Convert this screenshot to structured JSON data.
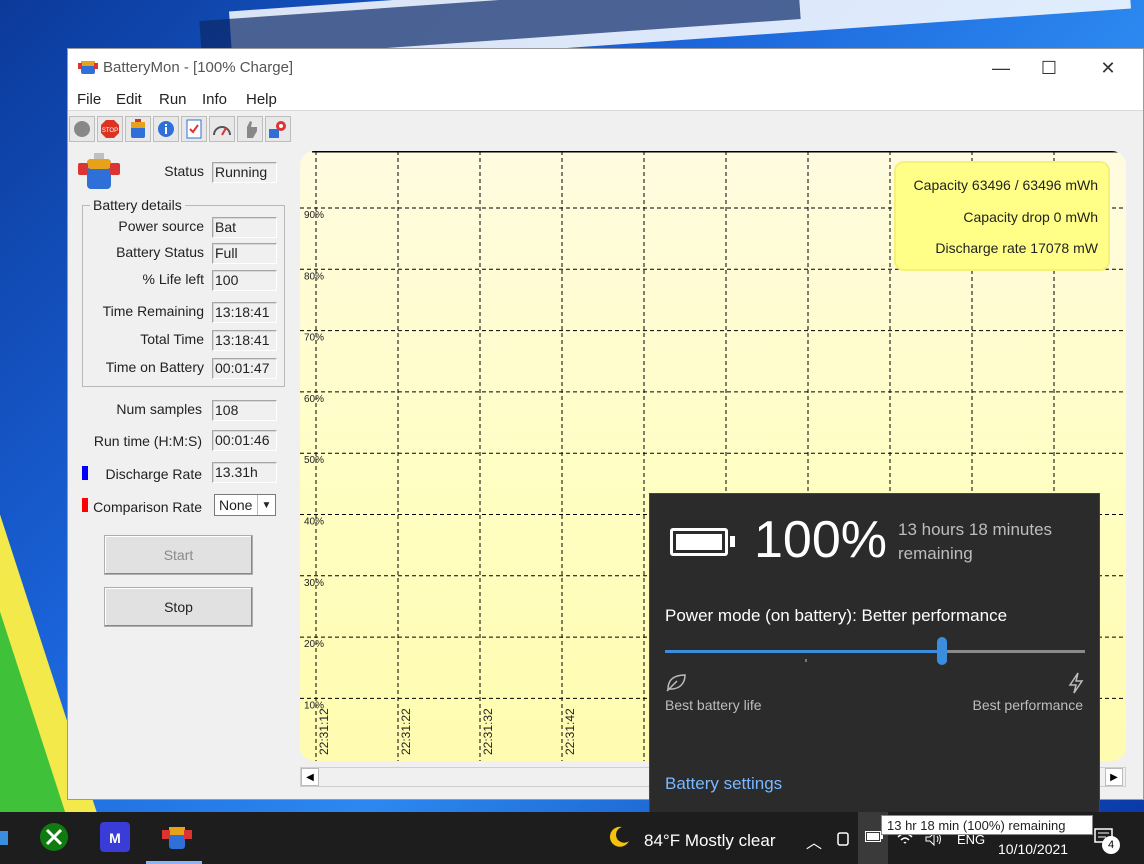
{
  "window": {
    "title": "BatteryMon - [100% Charge]",
    "minimize_glyph": "—",
    "maximize_glyph": "☐",
    "close_glyph": "✕"
  },
  "menu": [
    "File",
    "Edit",
    "Run",
    "Info",
    "Help"
  ],
  "toolbar_icons": [
    "record-icon",
    "stop-icon",
    "battery-icon",
    "info-icon",
    "checklist-icon",
    "gauge-icon",
    "hand-icon",
    "settings-icon"
  ],
  "panel": {
    "status_label": "Status",
    "status_value": "Running",
    "details_legend": "Battery details",
    "power_source_label": "Power source",
    "power_source_value": "Bat",
    "battery_status_label": "Battery Status",
    "battery_status_value": "Full",
    "life_left_label": "% Life left",
    "life_left_value": "100",
    "time_remaining_label": "Time Remaining",
    "time_remaining_value": "13:18:41",
    "total_time_label": "Total Time",
    "total_time_value": "13:18:41",
    "time_on_battery_label": "Time on Battery",
    "time_on_battery_value": "00:01:47",
    "num_samples_label": "Num samples",
    "num_samples_value": "108",
    "run_time_label": "Run time (H:M:S)",
    "run_time_value": "00:01:46",
    "discharge_rate_label": "Discharge Rate",
    "discharge_rate_value": "13.31h",
    "discharge_color": "#0000ff",
    "comparison_rate_label": "Comparison Rate",
    "comparison_rate_value": "None",
    "comparison_color": "#ff0000",
    "start_label": "Start",
    "stop_label": "Stop"
  },
  "chart": {
    "y_ticks": [
      "90%",
      "80%",
      "70%",
      "60%",
      "50%",
      "40%",
      "30%",
      "20%",
      "10%"
    ],
    "x_ticks": [
      "22:31:12",
      "22:31:22",
      "22:31:32",
      "22:31:42"
    ],
    "capacity": "Capacity 63496 / 63496 mWh",
    "capacity_drop": "Capacity drop 0 mWh",
    "discharge_rate": "Discharge rate 17078 mW"
  },
  "flyout": {
    "percent": "100%",
    "remaining": "13 hours 18 minutes remaining",
    "power_mode": "Power mode (on battery): Better performance",
    "power_mode_level": 0.66,
    "best_battery_life": "Best battery life",
    "best_performance": "Best performance",
    "battery_settings": "Battery settings"
  },
  "taskbar": {
    "weather": "84°F  Mostly clear",
    "tooltip": "13 hr 18 min (100%) remaining",
    "lang": "ENG",
    "date": "10/10/2021",
    "notification_count": "4"
  }
}
